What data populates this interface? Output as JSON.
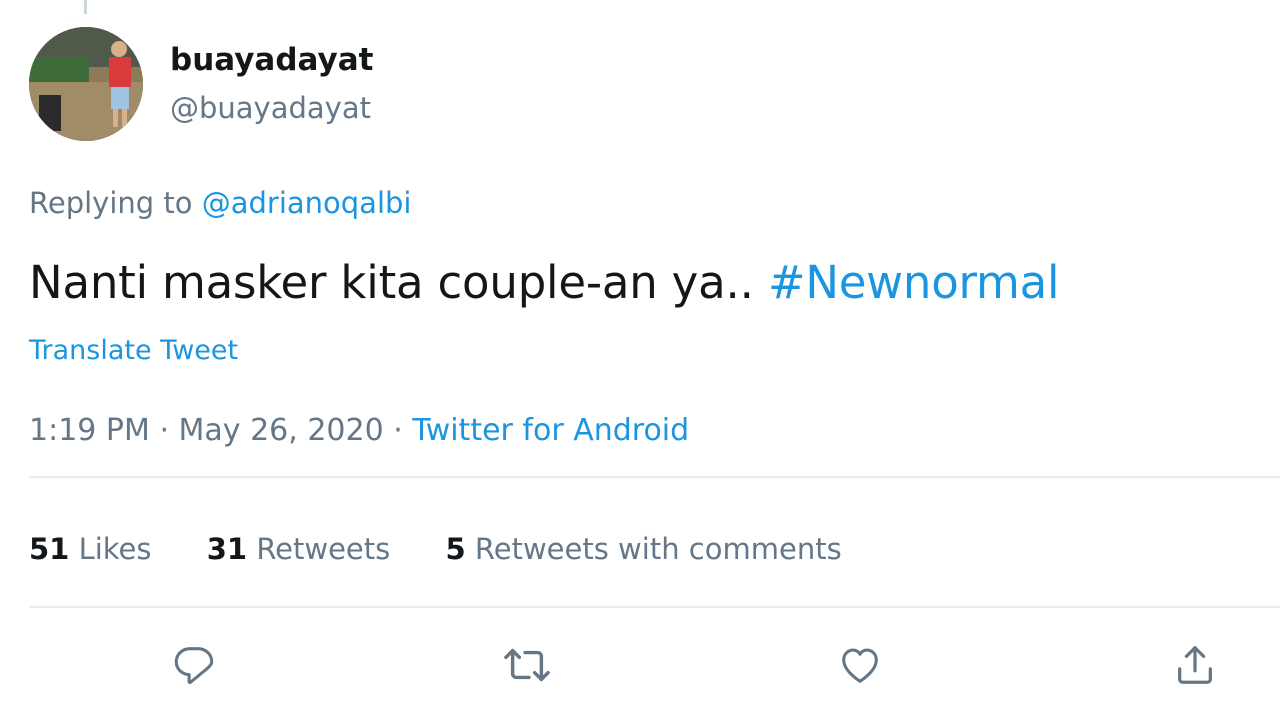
{
  "author": {
    "display_name": "buayadayat",
    "handle": "@buayadayat"
  },
  "reply": {
    "prefix": "Replying to",
    "to_handle": "@adrianoqalbi"
  },
  "tweet": {
    "text": "Nanti masker kita couple-an ya..",
    "hashtag": "#Newnormal",
    "translate_label": "Translate Tweet"
  },
  "meta": {
    "time": "1:19 PM",
    "separator": "·",
    "date": "May 26, 2020",
    "source": "Twitter for Android"
  },
  "stats": {
    "likes_count": "51",
    "likes_label": "Likes",
    "retweets_count": "31",
    "retweets_label": "Retweets",
    "quotes_count": "5",
    "quotes_label": "Retweets with comments"
  },
  "actions": {
    "reply_icon": "reply-icon",
    "retweet_icon": "retweet-icon",
    "like_icon": "heart-icon",
    "share_icon": "share-icon"
  },
  "colors": {
    "link": "#1b95e0",
    "secondary_text": "#657786",
    "primary_text": "#14171a",
    "divider": "#e6ecf0"
  }
}
